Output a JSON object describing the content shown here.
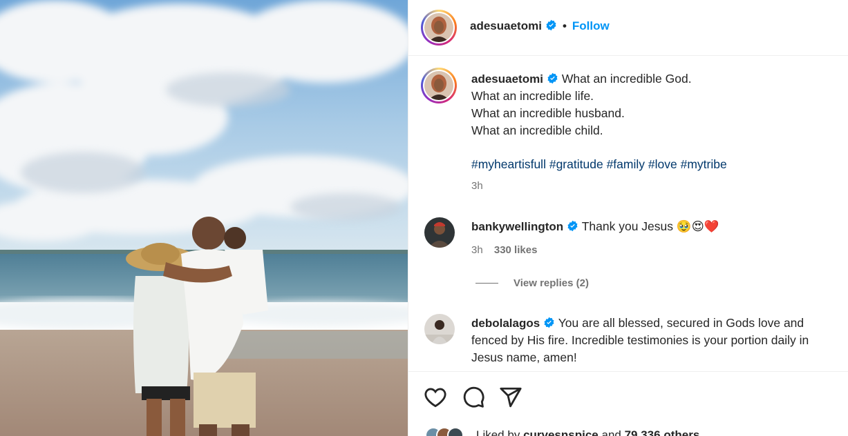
{
  "post": {
    "author": "adesuaetomi",
    "verified": true,
    "follow_label": "Follow",
    "separator": "•",
    "caption_first": "What an incredible God.",
    "caption_lines": [
      "What an incredible life.",
      "What an incredible husband.",
      "What an incredible child."
    ],
    "hashtags": [
      "#myheartisfull",
      "#gratitude",
      "#family",
      "#love",
      "#mytribe"
    ],
    "time": "3h"
  },
  "comments": [
    {
      "user": "bankywellington",
      "verified": true,
      "text": "Thank you Jesus ",
      "emojis": "🥹😍❤️",
      "time": "3h",
      "likes": "330 likes",
      "view_replies": "View replies (2)"
    },
    {
      "user": "debolalagos",
      "verified": true,
      "text": "You are all blessed, secured in Gods love and fenced by His fire. Incredible testimonies is your portion daily in Jesus name, amen!"
    }
  ],
  "likes": {
    "prefix": "Liked by ",
    "user": "curvesnspice",
    "middle": " and ",
    "count": "79,336 others"
  },
  "icons": {
    "like": "heart-icon",
    "comment": "comment-bubble-icon",
    "share": "paper-plane-icon",
    "verified": "verified-badge-icon"
  },
  "colors": {
    "link": "#0095f6",
    "hashtag": "#00376b",
    "muted": "#737373",
    "text": "#262626"
  }
}
